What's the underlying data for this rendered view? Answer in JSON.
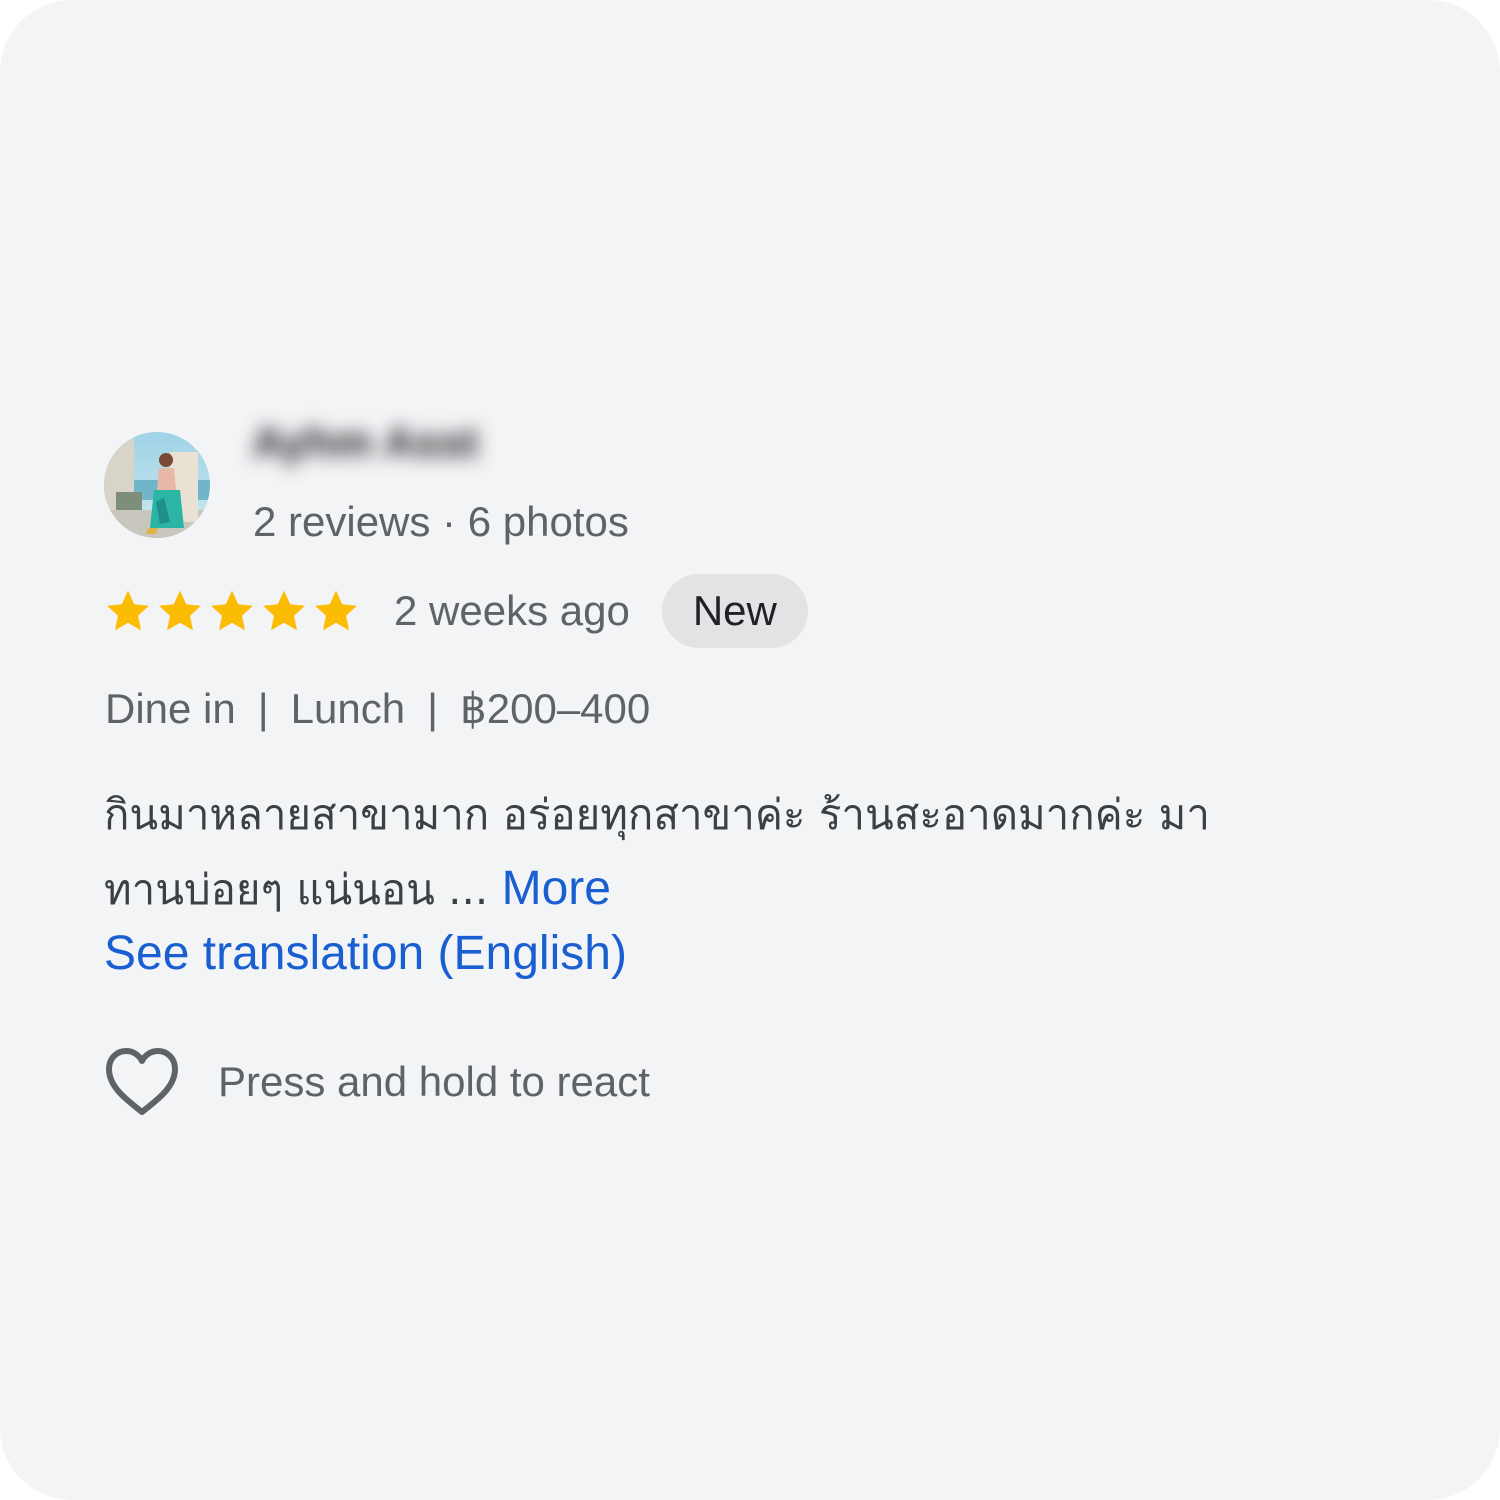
{
  "reviewer": {
    "name": "Ayhm Asst",
    "meta": "2 reviews · 6 photos"
  },
  "rating": {
    "stars": 5,
    "max_stars": 5,
    "star_color": "#fbbc04",
    "time_ago": "2 weeks ago",
    "badge": "New"
  },
  "tags": {
    "service": "Dine in",
    "meal": "Lunch",
    "price": "฿200–400",
    "separator": "|"
  },
  "review": {
    "line1": "กินมาหลายสาขามาก อร่อยทุกสาขาค่ะ ร้านสะอาดมากค่ะ มา",
    "line2": "ทานบ่อยๆ แน่นอน ...",
    "more_label": "More"
  },
  "translate": {
    "label": "See translation (English)"
  },
  "reaction": {
    "label": "Press and hold to react"
  },
  "colors": {
    "link": "#1a5fd1",
    "background": "#f3f4f6",
    "badge_bg": "#e2e3e5"
  }
}
